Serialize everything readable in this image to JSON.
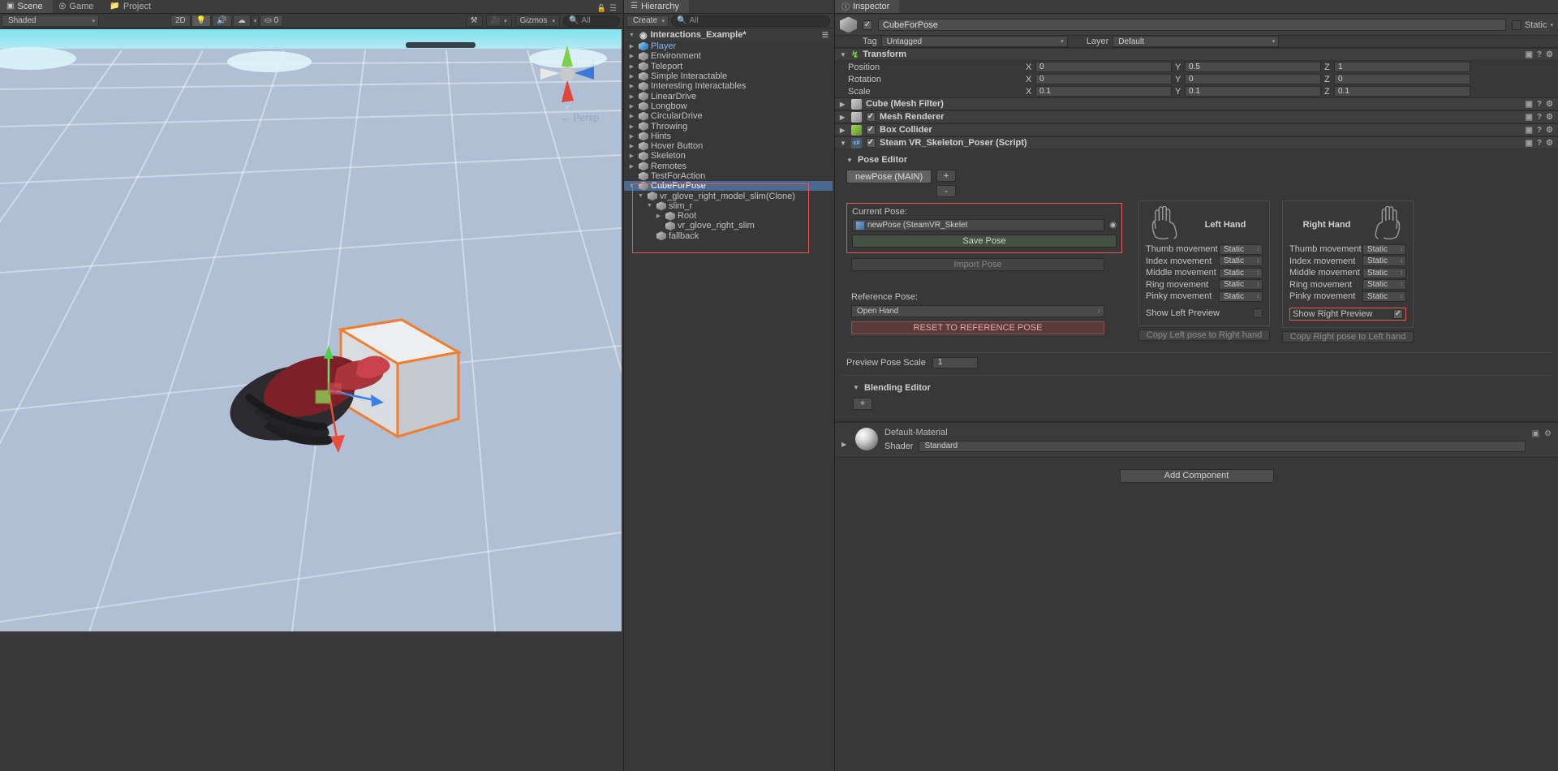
{
  "scene_panel": {
    "tabs": [
      {
        "label": "Scene",
        "icon": "grid-icon",
        "active": true
      },
      {
        "label": "Game",
        "icon": "gamepad-icon",
        "active": false
      },
      {
        "label": "Project",
        "icon": "folder-icon",
        "active": false
      }
    ],
    "toolbar": {
      "draw_mode": "Shaded",
      "dimension_toggle": "2D",
      "lighting_icon": "lightbulb-icon",
      "audio_icon": "speaker-icon",
      "effects_icon": "fx-icon",
      "hidden_count": "0",
      "hidden_icon": "eye-off-icon",
      "tools_icon": "tools-icon",
      "camera_icon": "camera-icon",
      "gizmos_label": "Gizmos",
      "search_placeholder": "All"
    },
    "viewport": {
      "persp_label": "Persp",
      "axis_y": "Y",
      "axis_z": "Z",
      "axis_x": "X"
    }
  },
  "hierarchy": {
    "tab_label": "Hierarchy",
    "tab_icon": "hierarchy-icon",
    "create_label": "Create",
    "search_placeholder": "All",
    "scene_name": "Interactions_Example*",
    "items": [
      {
        "label": "Player",
        "depth": 1,
        "expandable": true,
        "blue": true
      },
      {
        "label": "Environment",
        "depth": 1,
        "expandable": true,
        "blue": false
      },
      {
        "label": "Teleport",
        "depth": 1,
        "expandable": true,
        "blue": false
      },
      {
        "label": "Simple Interactable",
        "depth": 1,
        "expandable": true,
        "blue": false
      },
      {
        "label": "Interesting Interactables",
        "depth": 1,
        "expandable": true,
        "blue": false
      },
      {
        "label": "LinearDrive",
        "depth": 1,
        "expandable": true,
        "blue": false
      },
      {
        "label": "Longbow",
        "depth": 1,
        "expandable": true,
        "blue": false
      },
      {
        "label": "CircularDrive",
        "depth": 1,
        "expandable": true,
        "blue": false
      },
      {
        "label": "Throwing",
        "depth": 1,
        "expandable": true,
        "blue": false
      },
      {
        "label": "Hints",
        "depth": 1,
        "expandable": true,
        "blue": false
      },
      {
        "label": "Hover Button",
        "depth": 1,
        "expandable": true,
        "blue": false
      },
      {
        "label": "Skeleton",
        "depth": 1,
        "expandable": true,
        "blue": false
      },
      {
        "label": "Remotes",
        "depth": 1,
        "expandable": true,
        "blue": false
      },
      {
        "label": "TestForAction",
        "depth": 1,
        "expandable": false,
        "blue": false
      },
      {
        "label": "CubeForPose",
        "depth": 1,
        "expandable": true,
        "expanded": true,
        "selected": true,
        "blue": false
      },
      {
        "label": "vr_glove_right_model_slim(Clone)",
        "depth": 2,
        "expandable": true,
        "expanded": true,
        "blue": false
      },
      {
        "label": "slim_r",
        "depth": 3,
        "expandable": true,
        "expanded": true,
        "blue": false
      },
      {
        "label": "Root",
        "depth": 4,
        "expandable": true,
        "blue": false
      },
      {
        "label": "vr_glove_right_slim",
        "depth": 4,
        "expandable": false,
        "blue": false
      },
      {
        "label": "fallback",
        "depth": 3,
        "expandable": false,
        "blue": false
      }
    ]
  },
  "inspector": {
    "tab_label": "Inspector",
    "tab_icon": "info-icon",
    "object_name": "CubeForPose",
    "object_enabled": true,
    "static_label": "Static",
    "static_checked": false,
    "tag_label": "Tag",
    "tag_value": "Untagged",
    "layer_label": "Layer",
    "layer_value": "Default",
    "transform": {
      "title": "Transform",
      "rows": [
        {
          "label": "Position",
          "x": "0",
          "y": "0.5",
          "z": "1"
        },
        {
          "label": "Rotation",
          "x": "0",
          "y": "0",
          "z": "0"
        },
        {
          "label": "Scale",
          "x": "0.1",
          "y": "0.1",
          "z": "0.1"
        }
      ],
      "axis_labels": {
        "x": "X",
        "y": "Y",
        "z": "Z"
      }
    },
    "components": [
      {
        "title": "Cube (Mesh Filter)",
        "icon": "mesh-filter-icon",
        "has_checkbox": false
      },
      {
        "title": "Mesh Renderer",
        "icon": "mesh-renderer-icon",
        "has_checkbox": true,
        "checked": true
      },
      {
        "title": "Box Collider",
        "icon": "box-collider-icon",
        "has_checkbox": true,
        "checked": true
      },
      {
        "title": "Steam VR_Skeleton_Poser (Script)",
        "icon": "script-icon",
        "has_checkbox": true,
        "checked": true
      }
    ],
    "pose_editor": {
      "title": "Pose Editor",
      "pose_tab": "newPose (MAIN)",
      "add_button": "+",
      "remove_button": "-",
      "current_pose_label": "Current Pose:",
      "current_pose_value": "newPose (SteamVR_Skelet",
      "current_pose_picker_icon": "target-picker-icon",
      "save_pose_button": "Save Pose",
      "import_pose_button": "Import Pose",
      "reference_pose_label": "Reference Pose:",
      "reference_pose_value": "Open Hand",
      "reset_button": "RESET TO REFERENCE POSE",
      "preview_pose_scale_label": "Preview Pose Scale",
      "preview_pose_scale_value": "1",
      "hands": [
        {
          "title": "Left Hand",
          "hand_icon": "left-hand-outline-icon",
          "movements": [
            {
              "label": "Thumb movement",
              "value": "Static"
            },
            {
              "label": "Index movement",
              "value": "Static"
            },
            {
              "label": "Middle movement",
              "value": "Static"
            },
            {
              "label": "Ring movement",
              "value": "Static"
            },
            {
              "label": "Pinky movement",
              "value": "Static"
            }
          ],
          "preview_label": "Show Left Preview",
          "preview_checked": false,
          "preview_highlighted": false,
          "copy_button": "Copy Left pose to Right hand"
        },
        {
          "title": "Right Hand",
          "hand_icon": "right-hand-outline-icon",
          "movements": [
            {
              "label": "Thumb movement",
              "value": "Static"
            },
            {
              "label": "Index movement",
              "value": "Static"
            },
            {
              "label": "Middle movement",
              "value": "Static"
            },
            {
              "label": "Ring movement",
              "value": "Static"
            },
            {
              "label": "Pinky movement",
              "value": "Static"
            }
          ],
          "preview_label": "Show Right Preview",
          "preview_checked": true,
          "preview_highlighted": true,
          "copy_button": "Copy Right pose to Left hand"
        }
      ]
    },
    "blending_editor": {
      "title": "Blending Editor",
      "add_button": "+"
    },
    "material": {
      "name": "Default-Material",
      "shader_label": "Shader",
      "shader_value": "Standard"
    },
    "add_component_button": "Add Component"
  },
  "colors": {
    "highlight_red": "#e05b5b",
    "selection_blue": "#4a6a92",
    "panel_bg": "#383838",
    "header_bg": "#3c3c3c",
    "cube_outline": "#f07e30"
  }
}
